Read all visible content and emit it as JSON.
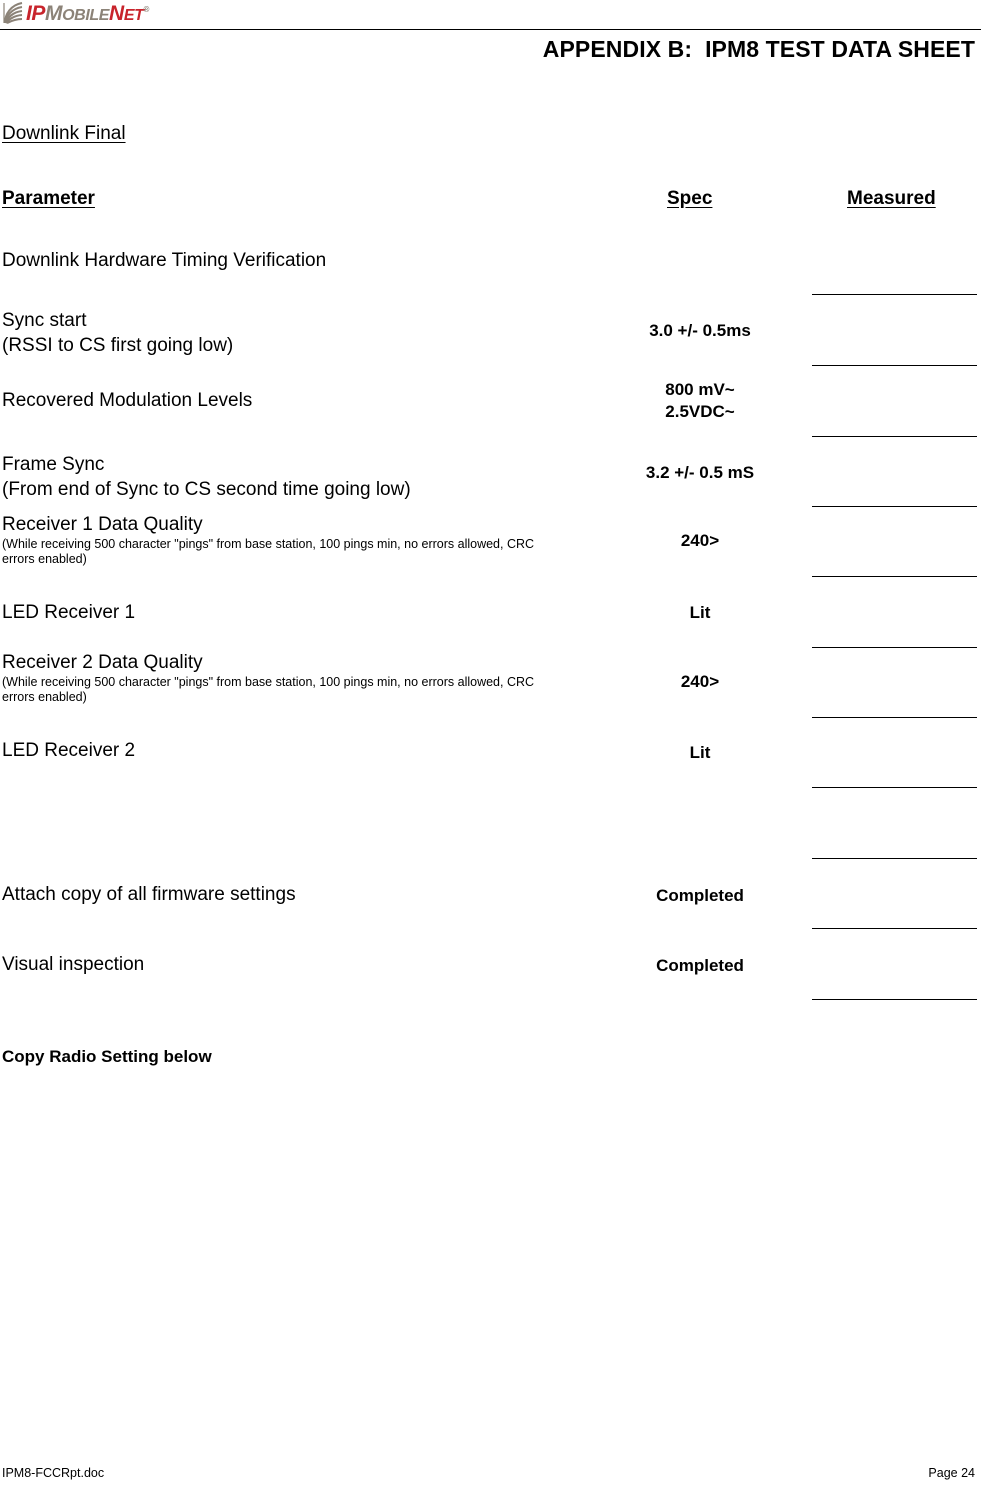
{
  "header": {
    "logo": {
      "icon_name": "signal-waves-icon",
      "part1": "IP",
      "part2": "M",
      "part3": "OBILE",
      "part4": "N",
      "part5": "ET",
      "trademark": "®",
      "color_red": "#C8242C",
      "color_gray": "#8C8378"
    },
    "title": "APPENDIX B:  IPM8 TEST DATA SHEET"
  },
  "section": {
    "title": "Downlink Final"
  },
  "columns": {
    "parameter": "Parameter",
    "spec": "Spec",
    "measured": "Measured"
  },
  "rows": [
    {
      "parameter": "Downlink Hardware Timing Verification",
      "sub": "",
      "spec": ""
    },
    {
      "parameter": "Sync start\n(RSSI to CS first going low)",
      "sub": "",
      "spec": "3.0 +/- 0.5ms"
    },
    {
      "parameter": "Recovered Modulation Levels",
      "sub": "",
      "spec": "800 mV~\n2.5VDC~"
    },
    {
      "parameter": "Frame Sync\n(From end of Sync to CS second time going low)",
      "sub": "",
      "spec": "3.2 +/- 0.5 mS"
    },
    {
      "parameter": "Receiver 1  Data Quality",
      "sub": "(While receiving 500 character \"pings\" from base station, 100 pings min, no errors allowed, CRC errors enabled)",
      "spec": "240>"
    },
    {
      "parameter": "LED Receiver 1",
      "sub": "",
      "spec": "Lit"
    },
    {
      "parameter": "Receiver 2 Data Quality",
      "sub": "(While receiving 500 character \"pings\" from base station, 100 pings min, no errors allowed, CRC errors enabled)",
      "spec": "240>"
    },
    {
      "parameter": "LED Receiver 2",
      "sub": "",
      "spec": "Lit"
    },
    {
      "parameter": "",
      "sub": "",
      "spec": ""
    },
    {
      "parameter": "Attach copy of all firmware settings",
      "sub": "",
      "spec": "Completed"
    },
    {
      "parameter": "Visual inspection",
      "sub": "",
      "spec": "Completed"
    }
  ],
  "note": "Copy Radio Setting below",
  "footer": {
    "filename": "IPM8-FCCRpt.doc",
    "page": "Page 24"
  }
}
